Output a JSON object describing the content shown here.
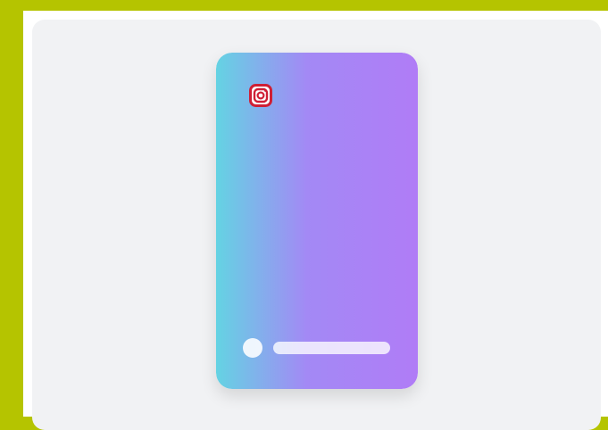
{
  "colors": {
    "frame_border": "#b5c400",
    "panel_background": "#f1f2f4",
    "card_gradient_start": "#64d3e3",
    "card_gradient_mid": "#a389f5",
    "card_gradient_end": "#b07cf6",
    "instagram_icon": "#cf1f35"
  },
  "icons": {
    "story_brand": "instagram-icon"
  }
}
